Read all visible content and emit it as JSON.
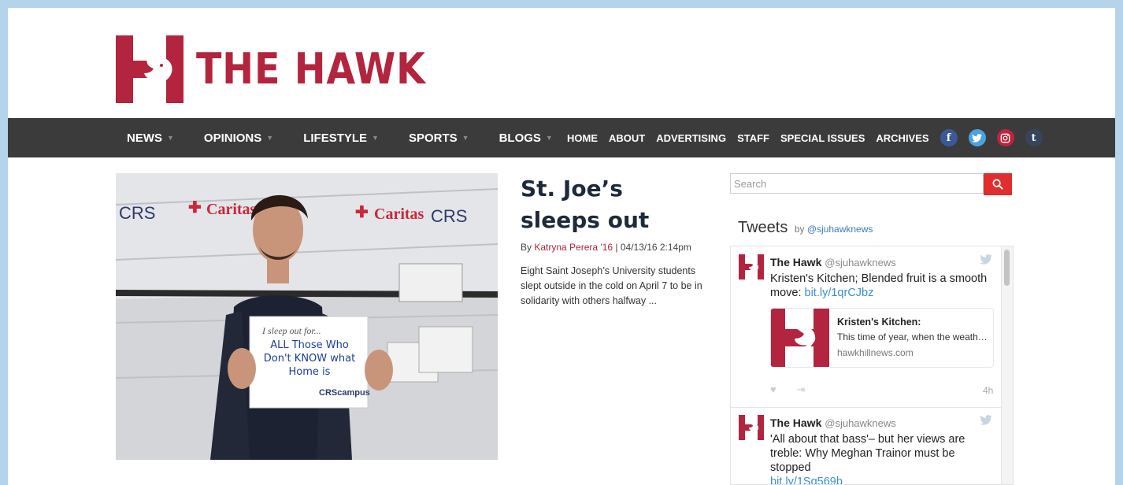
{
  "brand": {
    "name": "THE HAWK",
    "color": "#b3243e"
  },
  "nav": {
    "primary": [
      {
        "label": "NEWS"
      },
      {
        "label": "OPINIONS"
      },
      {
        "label": "LIFESTYLE"
      },
      {
        "label": "SPORTS"
      },
      {
        "label": "BLOGS"
      }
    ],
    "secondary": [
      {
        "label": "HOME"
      },
      {
        "label": "ABOUT"
      },
      {
        "label": "ADVERTISING"
      },
      {
        "label": "STAFF"
      },
      {
        "label": "SPECIAL ISSUES"
      },
      {
        "label": "ARCHIVES"
      }
    ],
    "social": [
      {
        "icon": "facebook-icon",
        "glyph": "f",
        "color": "#3b5998"
      },
      {
        "icon": "twitter-icon",
        "glyph": "t",
        "color": "#4aa3df"
      },
      {
        "icon": "instagram-icon",
        "glyph": "◙",
        "color": "#c1233f"
      },
      {
        "icon": "tumblr-icon",
        "glyph": "t",
        "color": "#35465c"
      }
    ]
  },
  "article": {
    "headline": "St. Joe’s sleeps out",
    "by_prefix": "By",
    "author": "Katryna Perera '16",
    "date": "| 04/13/16 2:14pm",
    "excerpt": "Eight Saint Joseph’s University students slept outside in the cold on April 7 to be in solidarity with others halfway ...",
    "photo": {
      "sign_heading": "I sleep out for...",
      "sign_text": "ALL Those Who Don't KNOW what Home is",
      "banner_caritas": "Caritas",
      "banner_crs": "CRS",
      "sign_logo": "CRScampus"
    }
  },
  "sidebar": {
    "search_placeholder": "Search",
    "tweets_title": "Tweets",
    "tweets_by": "by",
    "tweets_handle": "@sjuhawknews",
    "tweets": [
      {
        "name": "The Hawk",
        "handle": "@sjuhawknews",
        "text": "Kristen's Kitchen; Blended fruit is a smooth move: ",
        "link": "bit.ly/1qrCJbz",
        "card": {
          "title": "Kristen's Kitchen:",
          "description": "This time of year, when the weath…",
          "domain": "hawkhillnews.com"
        },
        "time": "4h"
      },
      {
        "name": "The Hawk",
        "handle": "@sjuhawknews",
        "text": "'All about that bass'– but her views are treble: Why Meghan Trainor must be stopped",
        "link": "bit.ly/1Sg569b"
      }
    ]
  }
}
